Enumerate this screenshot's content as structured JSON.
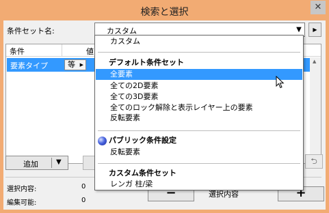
{
  "window": {
    "title": "検索と選択",
    "close_glyph": "✕"
  },
  "set_name": {
    "label": "条件セット名:",
    "value": "カスタム",
    "arrow_glyph": "▼",
    "nav_glyph": "▶"
  },
  "list": {
    "headers": [
      "条件",
      "値"
    ],
    "rows": [
      {
        "condition": "要素タイプ",
        "operator": "等"
      }
    ],
    "op_arrow_glyph": "▶",
    "scroll_up_glyph": "▲",
    "scroll_down_glyph": "▼"
  },
  "buttons": {
    "add": "追加",
    "add_arrow": "▼",
    "minus": "−",
    "plus": "+",
    "right_glyph": "⮌"
  },
  "status": [
    {
      "label": "選択内容:",
      "value": "0"
    },
    {
      "label": "編集可能:",
      "value": "0"
    }
  ],
  "selected_content_label": "選択内容",
  "dropdown": {
    "items": [
      {
        "text": "カスタム"
      },
      {
        "text": "デフォルト条件セット",
        "header": true
      },
      {
        "text": "全要素",
        "highlight": true
      },
      {
        "text": "全ての2D要素"
      },
      {
        "text": "全ての3D要素"
      },
      {
        "text": "全てのロック解除と表示レイヤー上の要素"
      },
      {
        "text": "反転要素"
      },
      {
        "text": "パブリック条件設定",
        "header": true,
        "icon": "globe-icon"
      },
      {
        "text": "反転要素"
      },
      {
        "text": "カスタム条件セット",
        "header": true
      },
      {
        "text": "レンガ  柱/梁"
      }
    ]
  },
  "colors": {
    "title_bar": "#f2ab73",
    "selection": "#3399ff",
    "client_bg": "#f0f0f0"
  }
}
